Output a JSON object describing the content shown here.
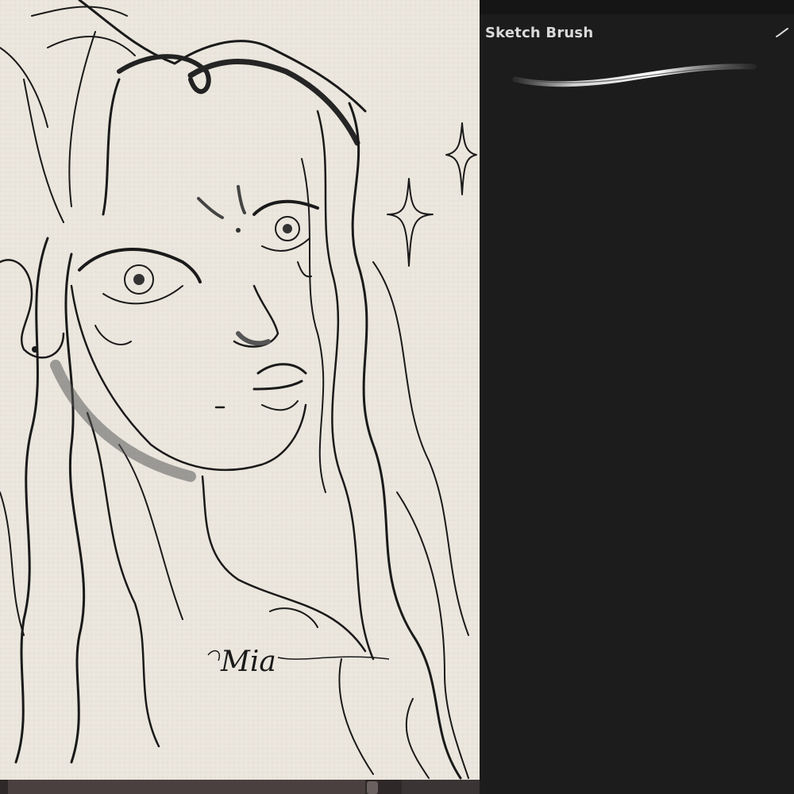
{
  "canvas": {
    "signature": "Mia",
    "paper_color": "#ebe6dd"
  },
  "brush_panel": {
    "selected_brush": {
      "name": "Sketch Brush",
      "icon": "brush-stroke-icon"
    },
    "background_color": "#1c1c1c",
    "text_color": "#d9d9d9"
  },
  "bottom_bar": {
    "color": "#2e2828"
  }
}
